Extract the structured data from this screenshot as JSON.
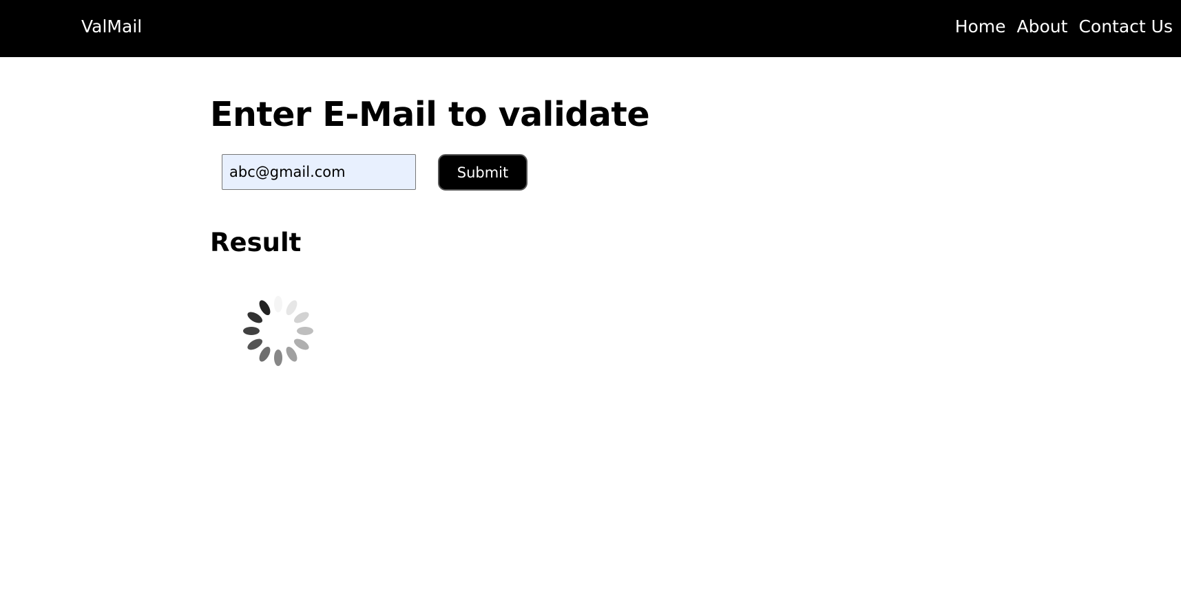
{
  "navbar": {
    "brand": "ValMail",
    "links": [
      {
        "label": "Home"
      },
      {
        "label": "About"
      },
      {
        "label": "Contact Us"
      }
    ]
  },
  "main": {
    "heading": "Enter E-Mail to validate",
    "email_input": {
      "value": "abc@gmail.com",
      "placeholder": ""
    },
    "submit_label": "Submit",
    "result_heading": "Result"
  },
  "spinner": {
    "icon": "loading-spinner-icon",
    "state": "loading"
  },
  "colors": {
    "navbar_bg": "#000000",
    "nav_text": "#ffffff",
    "input_bg": "#e8f0fe",
    "button_bg": "#000000",
    "button_text": "#ffffff"
  }
}
